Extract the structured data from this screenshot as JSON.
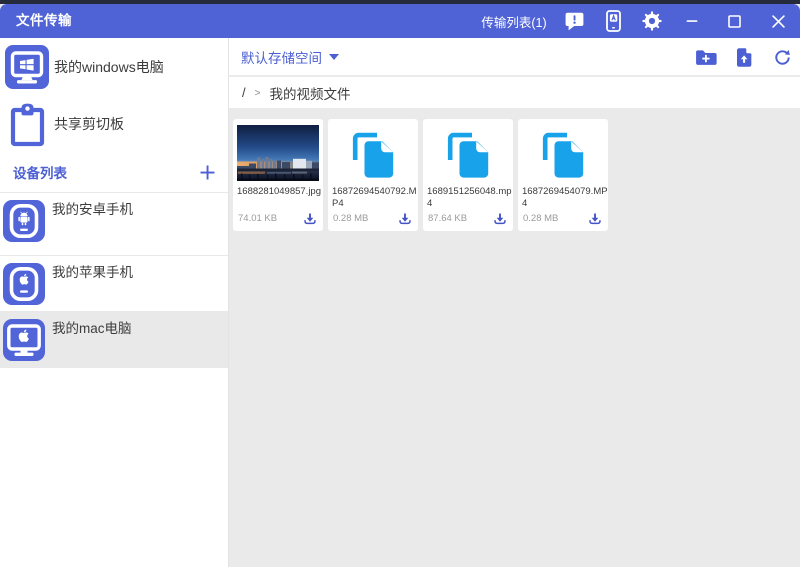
{
  "colors": {
    "primary_blue": "#4f63d6",
    "icon_blue": "#5164d8",
    "link_blue": "#4c5fd3",
    "file_icon_blue": "#18a2ea",
    "content_bg": "#eaeaea",
    "selected_row_bg": "#e9e9e9"
  },
  "titlebar": {
    "title": "文件传输",
    "transfer_list_label": "传输列表(1)"
  },
  "sidebar": {
    "computer": {
      "label": "我的windows电脑"
    },
    "clipboard": {
      "label": "共享剪切板"
    },
    "device_list_header": {
      "label": "设备列表",
      "add_button": "+"
    },
    "devices": [
      {
        "label": "我的安卓手机",
        "type": "android-phone",
        "selected": false
      },
      {
        "label": "我的苹果手机",
        "type": "apple-phone",
        "selected": false
      },
      {
        "label": "我的mac电脑",
        "type": "mac-computer",
        "selected": true
      }
    ]
  },
  "toolbar": {
    "storage_selector": "默认存储空间",
    "icons": [
      "new-folder",
      "upload-file",
      "refresh"
    ]
  },
  "breadcrumb": {
    "root": "/",
    "separator": ">",
    "current": "我的视频文件"
  },
  "files": [
    {
      "name": "1688281049857.jpg",
      "size": "74.01 KB",
      "kind": "image-thumbnail"
    },
    {
      "name": "16872694540792.MP4",
      "size": "0.28 MB",
      "kind": "file"
    },
    {
      "name": "1689151256048.mp4",
      "size": "87.64 KB",
      "kind": "file"
    },
    {
      "name": "1687269454079.MP4",
      "size": "0.28 MB",
      "kind": "file"
    }
  ]
}
